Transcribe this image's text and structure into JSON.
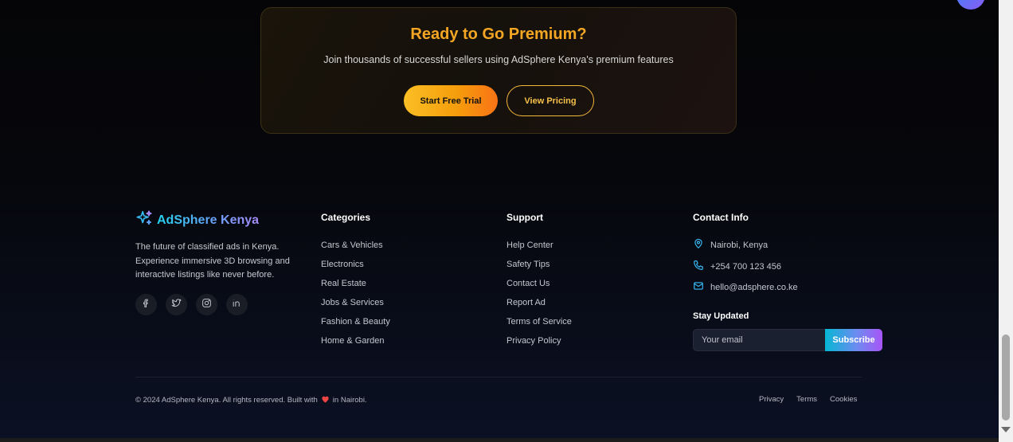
{
  "premium": {
    "title": "Ready to Go Premium?",
    "subtitle": "Join thousands of successful sellers using AdSphere Kenya's premium features",
    "primary_label": "Start Free Trial",
    "secondary_label": "View Pricing"
  },
  "brand": {
    "name": "AdSphere Kenya",
    "description": "The future of classified ads in Kenya. Experience immersive 3D browsing and interactive listings like never before."
  },
  "socials": [
    "facebook-icon",
    "twitter-icon",
    "instagram-icon",
    "linkedin-icon"
  ],
  "categories": {
    "title": "Categories",
    "items": [
      "Cars & Vehicles",
      "Electronics",
      "Real Estate",
      "Jobs & Services",
      "Fashion & Beauty",
      "Home & Garden"
    ]
  },
  "support": {
    "title": "Support",
    "items": [
      "Help Center",
      "Safety Tips",
      "Contact Us",
      "Report Ad",
      "Terms of Service",
      "Privacy Policy"
    ]
  },
  "contact": {
    "title": "Contact Info",
    "location": "Nairobi, Kenya",
    "phone": "+254 700 123 456",
    "email": "hello@adsphere.co.ke"
  },
  "newsletter": {
    "title": "Stay Updated",
    "placeholder": "Your email",
    "button_label": "Subscribe"
  },
  "footer": {
    "copyright_before": "© 2024 AdSphere Kenya. All rights reserved. Built with",
    "copyright_after": "in Nairobi.",
    "links": [
      "Privacy",
      "Terms",
      "Cookies"
    ]
  },
  "colors": {
    "accent_orange": "#f5a623",
    "accent_cyan": "#22d3ee",
    "accent_purple": "#a855f7",
    "heart": "#ef4444"
  }
}
